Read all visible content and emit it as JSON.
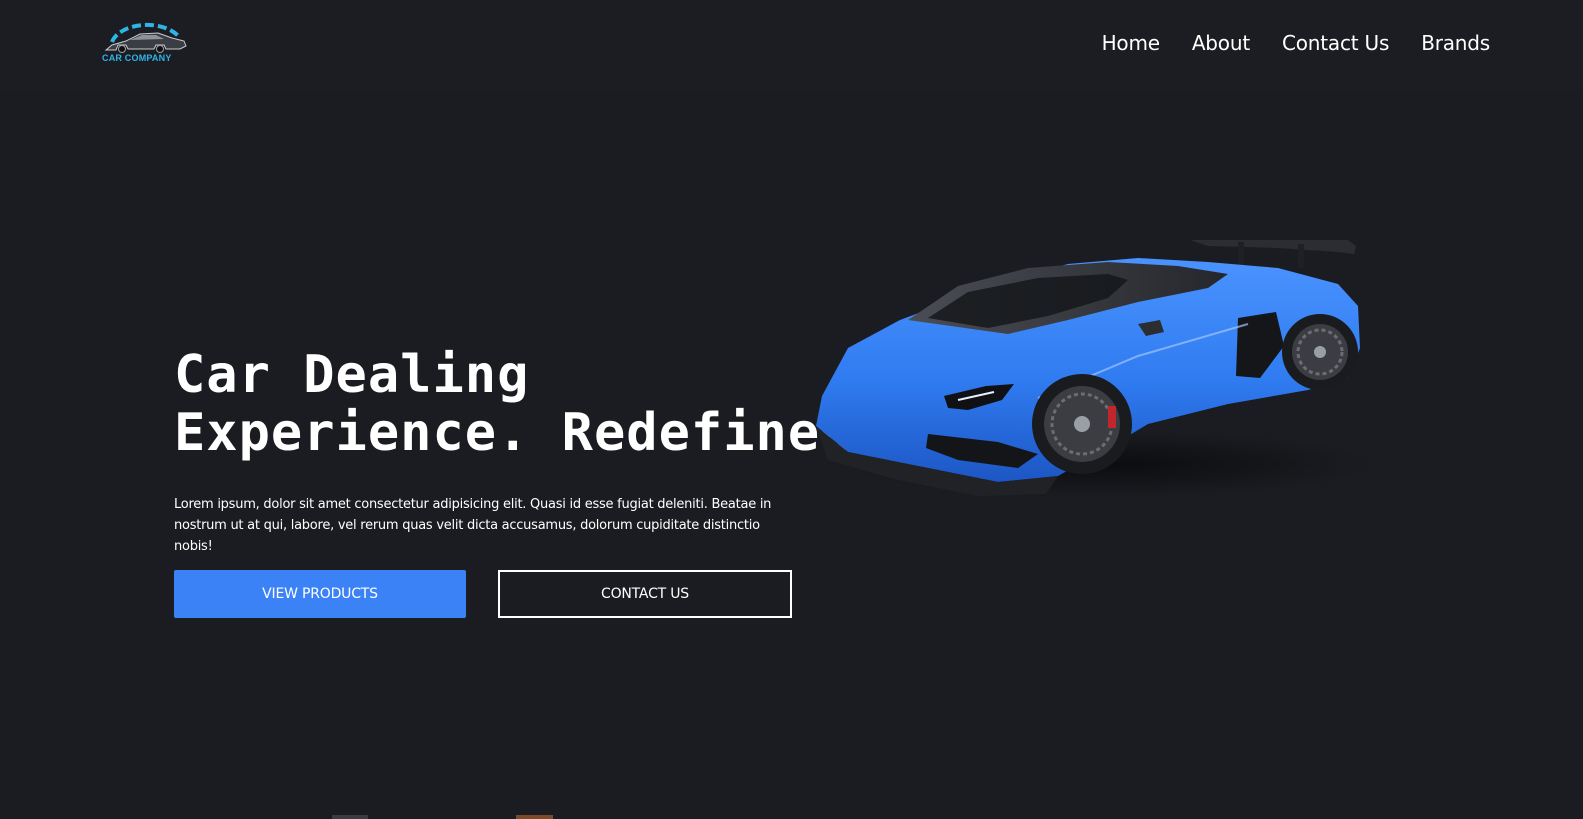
{
  "header": {
    "logo_text": "CAR COMPANY",
    "nav": [
      "Home",
      "About",
      "Contact Us",
      "Brands"
    ]
  },
  "hero": {
    "title_line1": "Car Dealing",
    "title_line2": "Experience. Redefined!",
    "description": "Lorem ipsum, dolor sit amet consectetur adipisicing elit. Quasi id esse fugiat deleniti. Beatae in nostrum ut at qui, labore, vel rerum quas velit dicta accusamus, dolorum cupiditate distinctio nobis!",
    "primary_button": "VIEW PRODUCTS",
    "secondary_button": "CONTACT US"
  },
  "colors": {
    "background": "#1b1c21",
    "accent": "#3b82f6",
    "logo_accent": "#2fb4e8",
    "car_blue": "#2f7bf0"
  },
  "icons": {
    "logo": "car-logo-icon",
    "hero_image": "blue-sports-car"
  }
}
